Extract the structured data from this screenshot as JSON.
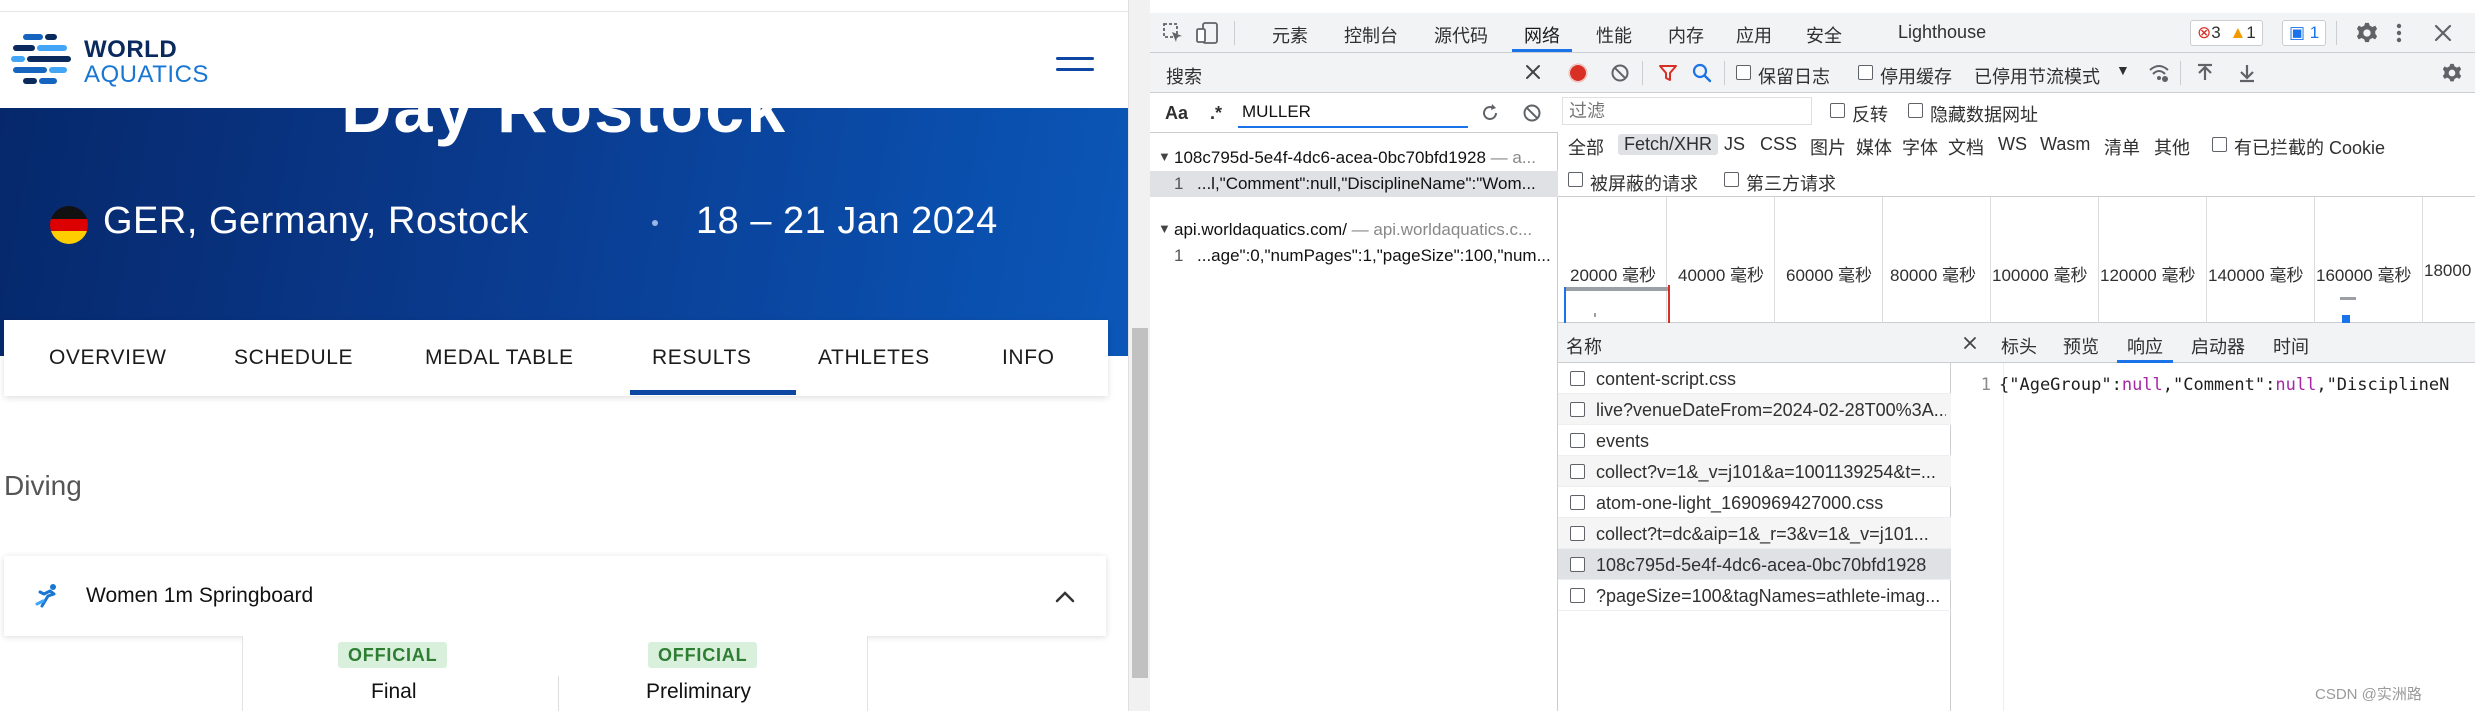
{
  "site": {
    "logo": {
      "line1": "WORLD",
      "line2": "AQUATICS"
    },
    "hero": {
      "title": "Day Rostock",
      "location": "GER, Germany, Rostock",
      "date": "18 – 21 Jan 2024"
    },
    "tabs": [
      "OVERVIEW",
      "SCHEDULE",
      "MEDAL TABLE",
      "RESULTS",
      "ATHLETES",
      "INFO"
    ],
    "active_tab": "RESULTS",
    "section_title": "Diving",
    "event": {
      "title": "Women 1m Springboard"
    },
    "results": [
      {
        "badge": "OFFICIAL",
        "label": "Final"
      },
      {
        "badge": "OFFICIAL",
        "label": "Preliminary"
      }
    ]
  },
  "devtools": {
    "tabs": [
      "元素",
      "控制台",
      "源代码",
      "网络",
      "性能",
      "内存",
      "应用",
      "安全",
      "Lighthouse"
    ],
    "active_tab": "网络",
    "errors": "3",
    "warnings": "1",
    "messages": "1",
    "search": {
      "header": "搜索",
      "case_label": "Aa",
      "regex_label": ".*",
      "query": "MULLER",
      "results": [
        {
          "type": "file",
          "name": "108c795d-5e4f-4dc6-acea-0bc70bfd1928",
          "sub": " — a..."
        },
        {
          "type": "match",
          "num": "1",
          "snippet": "...l,\"Comment\":null,\"DisciplineName\":\"Wom..."
        },
        {
          "type": "file",
          "name": "api.worldaquatics.com/",
          "sub": " — api.worldaquatics.c..."
        },
        {
          "type": "match",
          "num": "1",
          "snippet": "...age\":0,\"numPages\":1,\"pageSize\":100,\"num..."
        }
      ]
    },
    "network": {
      "preserve_log": "保留日志",
      "disable_cache": "停用缓存",
      "throttle": "已停用节流模式",
      "filter_placeholder": "过滤",
      "invert": "反转",
      "hide_data_urls": "隐藏数据网址",
      "types": [
        "全部",
        "Fetch/XHR",
        "JS",
        "CSS",
        "图片",
        "媒体",
        "字体",
        "文档",
        "WS",
        "Wasm",
        "清单",
        "其他"
      ],
      "active_type": "Fetch/XHR",
      "blocked_cookies": "有已拦截的 Cookie",
      "blocked_requests": "被屏蔽的请求",
      "third_party": "第三方请求",
      "timeline_labels": [
        "20000 毫秒",
        "40000 毫秒",
        "60000 毫秒",
        "80000 毫秒",
        "100000 毫秒",
        "120000 毫秒",
        "140000 毫秒",
        "160000 毫秒",
        "18000"
      ],
      "name_header": "名称",
      "requests": [
        "content-script.css",
        "live?venueDateFrom=2024-02-28T00%3A...",
        "events",
        "collect?v=1&_v=j101&a=1001139254&t=...",
        "atom-one-light_1690969427000.css",
        "collect?t=dc&aip=1&_r=3&v=1&_v=j101...",
        "108c795d-5e4f-4dc6-acea-0bc70bfd1928",
        "?pageSize=100&tagNames=athlete-imag..."
      ],
      "selected_request": 6,
      "detail_tabs": [
        "标头",
        "预览",
        "响应",
        "启动器",
        "时间"
      ],
      "active_detail_tab": "响应",
      "response_line_num": "1",
      "response_text": {
        "p1": "{\"AgeGroup\":",
        "p2": "null",
        "p3": ",\"Comment\":",
        "p4": "null",
        "p5": ",\"DisciplineN"
      }
    }
  },
  "watermark": "CSDN @实洲路",
  "colors": {
    "brand": "#0d47a1",
    "devtools_accent": "#1a73e8",
    "official_green": "#2e7d32"
  }
}
